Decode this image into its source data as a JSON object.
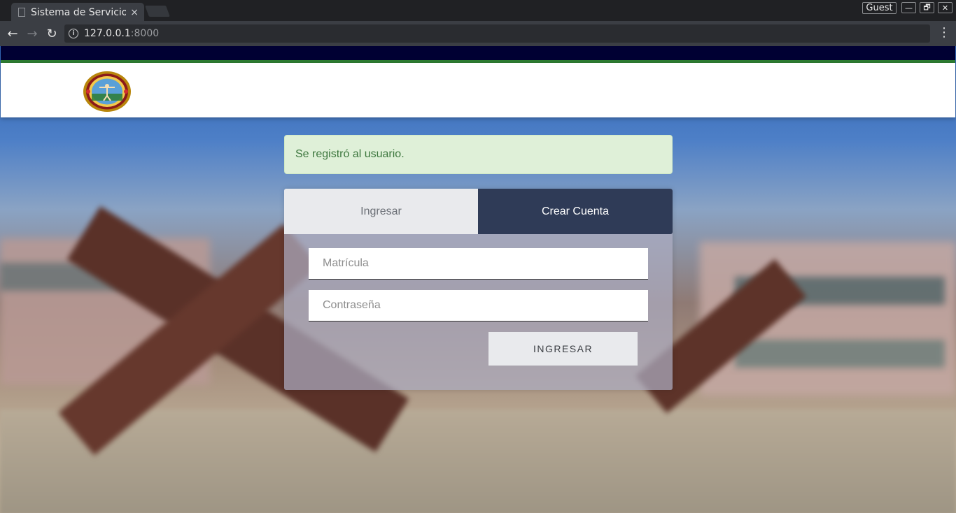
{
  "browser": {
    "tab_title": "Sistema de Servicio",
    "tab_close": "×",
    "guest_label": "Guest",
    "window_buttons": {
      "minimize": "—",
      "restore": "🗗",
      "close": "✕"
    },
    "url_host": "127.0.0.1",
    "url_port": ":8000",
    "nav": {
      "back": "←",
      "forward": "→",
      "reload": "↻",
      "menu": "⋮",
      "info": "i"
    }
  },
  "header": {
    "colors": {
      "top_band": "#000033",
      "stripe": "#2e7d32",
      "body": "#ffffff"
    },
    "logo_icon": "university-seal-icon"
  },
  "alert": {
    "message": "Se registró al usuario.",
    "color": "#3c763d",
    "background": "#dff0d8"
  },
  "auth": {
    "tabs": {
      "login": "Ingresar",
      "register": "Crear Cuenta"
    },
    "active_tab": "Crear Cuenta",
    "fields": {
      "matricula_placeholder": "Matrícula",
      "password_placeholder": "Contraseña"
    },
    "submit_label": "INGRESAR",
    "accent": "#2f3b57"
  }
}
